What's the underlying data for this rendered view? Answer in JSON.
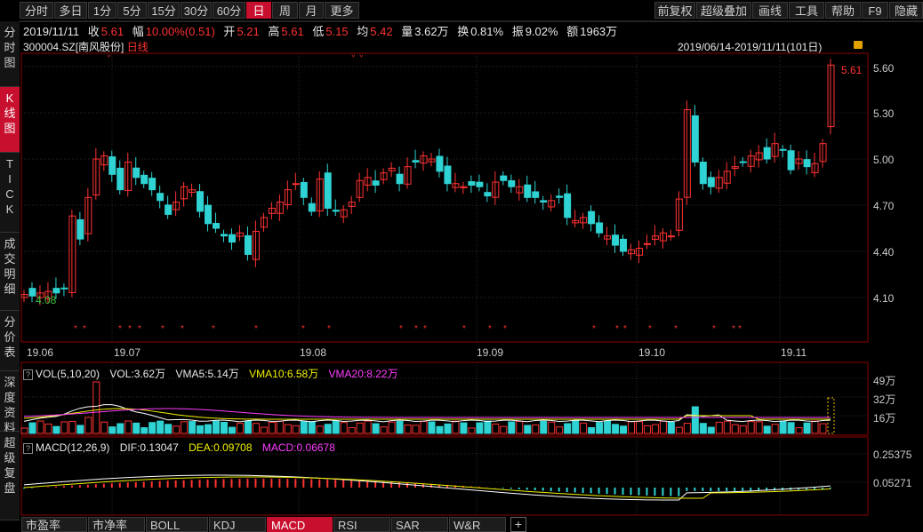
{
  "tabs": [
    "分时",
    "多日",
    "1分",
    "5分",
    "15分",
    "30分",
    "60分",
    "日",
    "周",
    "月",
    "更多"
  ],
  "active_tab": "日",
  "right_buttons": [
    "前复权",
    "超级叠加",
    "画线",
    "工具",
    "帮助",
    "F9",
    "隐藏"
  ],
  "sidebar": [
    {
      "label": "分时图"
    },
    {
      "label": "K线图",
      "active": true
    },
    {
      "label": "TICK"
    },
    {
      "label": "成交明细"
    },
    {
      "label": "分价表"
    },
    {
      "label": "深度资料"
    },
    {
      "label": "超级复盘"
    }
  ],
  "info": {
    "date": "2019/11/11",
    "close_label": "收",
    "close": "5.61",
    "range_label": "幅",
    "range": "10.00%(0.51)",
    "open_label": "开",
    "open": "5.21",
    "high_label": "高",
    "high": "5.61",
    "low_label": "低",
    "low": "5.15",
    "avg_label": "均",
    "avg": "5.42",
    "vol_label": "量",
    "vol": "3.62万",
    "turnover_label": "换",
    "turnover": "0.81%",
    "amp_label": "振",
    "amp": "9.02%",
    "amount_label": "额",
    "amount": "1963万"
  },
  "stock": {
    "code": "300004.SZ",
    "name": "[南风股份]",
    "period": "日线"
  },
  "date_range": "2019/06/14-2019/11/11(101日)",
  "price_labels": [
    "5.60",
    "5.30",
    "5.00",
    "4.70",
    "4.40",
    "4.10"
  ],
  "high_marker": "5.61",
  "low_marker": "4.08",
  "x_labels": [
    "19.06",
    "19.07",
    "19.08",
    "19.09",
    "19.10",
    "19.11"
  ],
  "vol": {
    "name": "VOL(5,10,20)",
    "vol": "VOL:3.62万",
    "vma5": "VMA5:5.14万",
    "vma10": "VMA10:6.58万",
    "vma20": "VMA20:8.22万",
    "labels": [
      "49万",
      "32万",
      "16万"
    ]
  },
  "macd": {
    "name": "MACD(12,26,9)",
    "dif": "DIF:0.13047",
    "dea": "DEA:0.09708",
    "macd": "MACD:0.06678",
    "labels": [
      "0.25375",
      "0.05271"
    ]
  },
  "bottom_tabs": [
    "市盈率",
    "市净率",
    "BOLL",
    "KDJ",
    "MACD",
    "RSI",
    "SAR",
    "W&R"
  ],
  "active_bottom": "MACD",
  "colors": {
    "up": "#ff3232",
    "down": "#2fd3d3",
    "vma5": "#ffffff",
    "vma10": "#f0f000",
    "vma20": "#ff3cff"
  }
}
